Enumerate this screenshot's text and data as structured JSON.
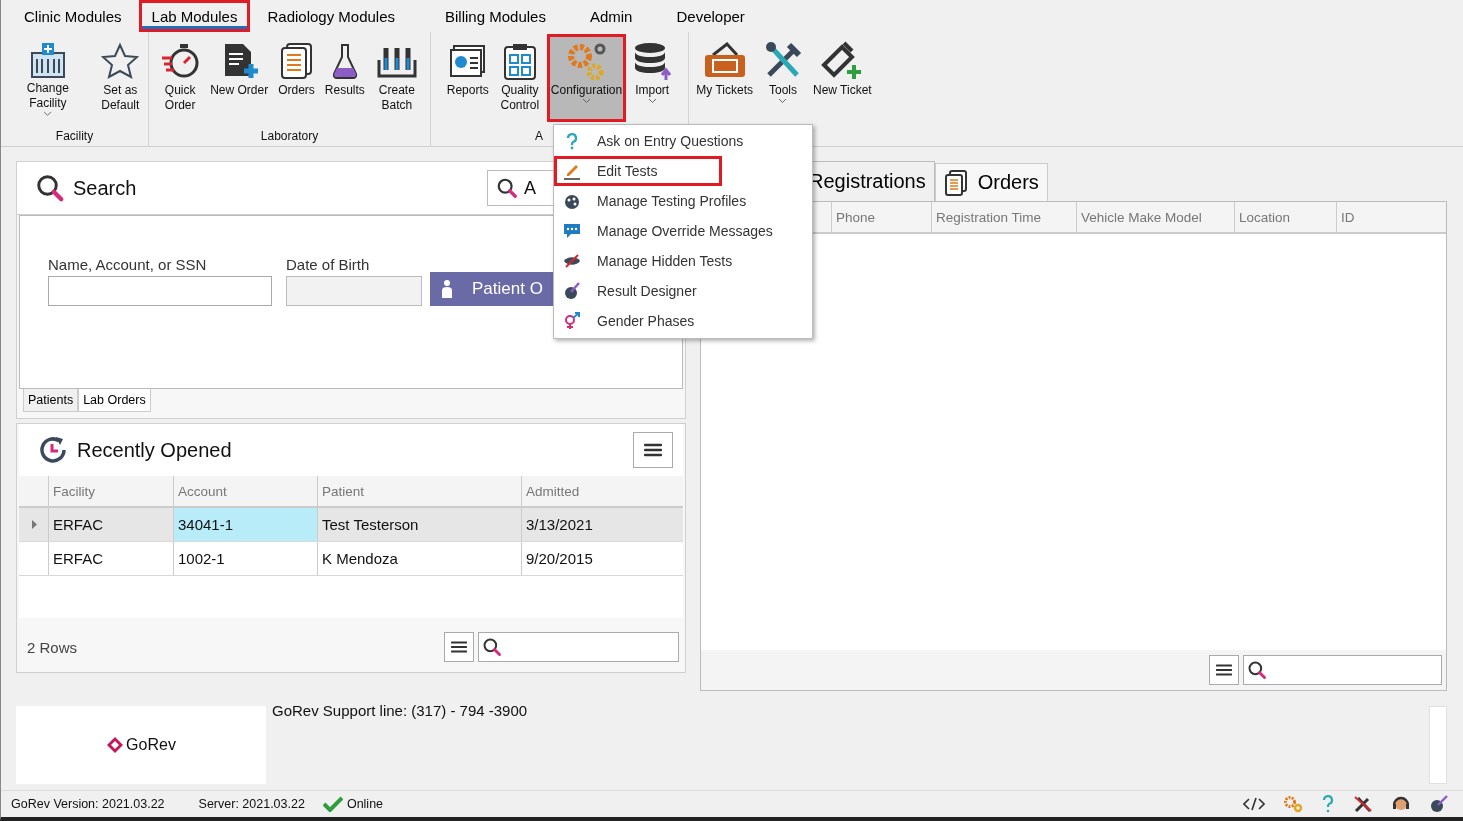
{
  "ribbon_tabs": [
    {
      "label": "Clinic Modules",
      "selected": false,
      "highlighted": false
    },
    {
      "label": "Lab Modules",
      "selected": true,
      "highlighted": true
    },
    {
      "label": "Radiology Modules",
      "selected": false,
      "highlighted": false
    },
    {
      "label": "Billing Modules",
      "selected": false,
      "highlighted": false
    },
    {
      "label": "Admin",
      "selected": false,
      "highlighted": false
    },
    {
      "label": "Developer",
      "selected": false,
      "highlighted": false
    }
  ],
  "ribbon_groups": [
    {
      "label": "Facility",
      "buttons": [
        {
          "label": "Change Facility",
          "dropdown": true,
          "pressed": false,
          "highlighted": false
        },
        {
          "label": "Set as Default",
          "dropdown": false,
          "pressed": false,
          "highlighted": false
        }
      ]
    },
    {
      "label": "Laboratory",
      "buttons": [
        {
          "label": "Quick Order",
          "dropdown": false,
          "pressed": false,
          "highlighted": false
        },
        {
          "label": "New Order",
          "dropdown": false,
          "pressed": false,
          "highlighted": false
        },
        {
          "label": "Orders",
          "dropdown": false,
          "pressed": false,
          "highlighted": false
        },
        {
          "label": "Results",
          "dropdown": false,
          "pressed": false,
          "highlighted": false
        },
        {
          "label": "Create Batch",
          "dropdown": false,
          "pressed": false,
          "highlighted": false
        }
      ]
    },
    {
      "label": "A",
      "buttons": [
        {
          "label": "Reports",
          "dropdown": false,
          "pressed": false,
          "highlighted": false
        },
        {
          "label": "Quality Control",
          "dropdown": false,
          "pressed": false,
          "highlighted": false
        },
        {
          "label": "Configuration",
          "dropdown": true,
          "pressed": true,
          "highlighted": true
        },
        {
          "label": "Import",
          "dropdown": true,
          "pressed": false,
          "highlighted": false
        }
      ]
    },
    {
      "buttons": [
        {
          "label": "My Tickets",
          "dropdown": false,
          "pressed": false,
          "highlighted": false
        },
        {
          "label": "Tools",
          "dropdown": true,
          "pressed": false,
          "highlighted": false
        },
        {
          "label": "New Ticket",
          "dropdown": false,
          "pressed": false,
          "highlighted": false
        }
      ]
    }
  ],
  "configuration_menu": [
    {
      "label": "Ask on Entry Questions",
      "highlighted": false
    },
    {
      "label": "Edit Tests",
      "highlighted": true
    },
    {
      "label": "Manage Testing Profiles",
      "highlighted": false
    },
    {
      "label": "Manage Override Messages",
      "highlighted": false
    },
    {
      "label": "Manage Hidden Tests",
      "highlighted": false
    },
    {
      "label": "Result Designer",
      "highlighted": false
    },
    {
      "label": "Gender Phases",
      "highlighted": false
    }
  ],
  "search_panel": {
    "title": "Search",
    "search_box": "A",
    "fields": [
      {
        "label": "Name, Account, or SSN",
        "disabled": false
      },
      {
        "label": "Date of Birth",
        "disabled": true
      }
    ],
    "button": "Patient O",
    "tabs": [
      {
        "label": "Patients",
        "selected": true
      },
      {
        "label": "Lab Orders",
        "selected": false
      }
    ]
  },
  "recently_opened": {
    "title": "Recently Opened",
    "columns": [
      "Facility",
      "Account",
      "Patient",
      "Admitted"
    ],
    "rows": [
      {
        "cells": [
          {
            "text": "ERFAC",
            "selected": false
          },
          {
            "text": "34041-1",
            "selected": true
          },
          {
            "text": "Test Testerson",
            "selected": false
          },
          {
            "text": "3/13/2021",
            "selected": false
          }
        ],
        "current": true
      },
      {
        "cells": [
          {
            "text": "ERFAC",
            "selected": false
          },
          {
            "text": "1002-1",
            "selected": false
          },
          {
            "text": "K Mendoza",
            "selected": false
          },
          {
            "text": "9/20/2015",
            "selected": false
          }
        ],
        "current": false
      }
    ],
    "row_count": "2 Rows"
  },
  "right_panel": {
    "tabs": [
      {
        "label": "Registrations",
        "selected": true
      },
      {
        "label": "Orders",
        "selected": false
      }
    ],
    "columns": [
      "Phone",
      "Registration Time",
      "Vehicle Make Model",
      "Location",
      "ID"
    ]
  },
  "footer": {
    "logo": "GoRev",
    "support_line": "GoRev Support line: (317) - 794 -3900"
  },
  "status_bar": {
    "version": "GoRev Version: 2021.03.22",
    "server": "Server: 2021.03.22",
    "connection": "Online",
    "online": true
  }
}
